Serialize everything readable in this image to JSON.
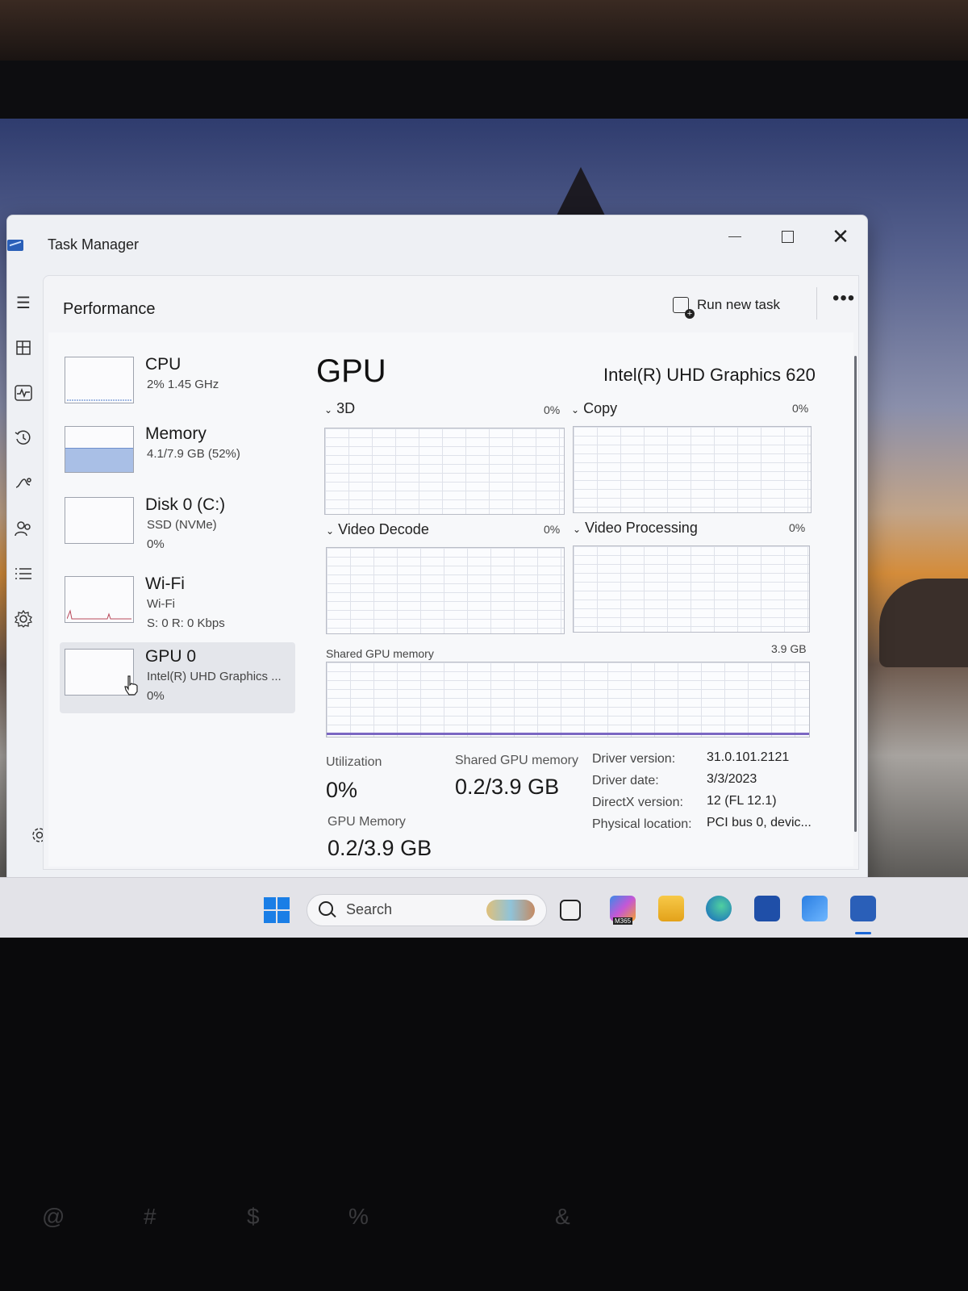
{
  "window": {
    "title": "Task Manager"
  },
  "header": {
    "section": "Performance",
    "run_task": "Run new task",
    "more": "•••"
  },
  "devices": [
    {
      "name": "CPU",
      "sub": "2%  1.45 GHz",
      "sub2": ""
    },
    {
      "name": "Memory",
      "sub": "4.1/7.9 GB (52%)",
      "sub2": "",
      "usage_fraction": 0.52
    },
    {
      "name": "Disk 0 (C:)",
      "sub": "SSD (NVMe)",
      "sub2": "0%"
    },
    {
      "name": "Wi-Fi",
      "sub": "Wi-Fi",
      "sub2": "S: 0  R: 0 Kbps"
    },
    {
      "name": "GPU 0",
      "sub": "Intel(R) UHD Graphics ...",
      "sub2": "0%"
    }
  ],
  "gpu": {
    "title": "GPU",
    "model": "Intel(R) UHD Graphics 620",
    "engines": [
      {
        "label": "3D",
        "pct": "0%"
      },
      {
        "label": "Copy",
        "pct": "0%"
      },
      {
        "label": "Video Decode",
        "pct": "0%"
      },
      {
        "label": "Video Processing",
        "pct": "0%"
      }
    ],
    "shared_label": "Shared GPU memory",
    "shared_max": "3.9 GB",
    "stats": {
      "utilization_label": "Utilization",
      "utilization": "0%",
      "shared_mem_label": "Shared GPU memory",
      "shared_mem": "0.2/3.9 GB",
      "gpu_mem_label": "GPU Memory",
      "gpu_mem": "0.2/3.9 GB"
    },
    "details": [
      {
        "key": "Driver version:",
        "value": "31.0.101.2121"
      },
      {
        "key": "Driver date:",
        "value": "3/3/2023"
      },
      {
        "key": "DirectX version:",
        "value": "12 (FL 12.1)"
      },
      {
        "key": "Physical location:",
        "value": "PCI bus 0, devic..."
      }
    ]
  },
  "taskbar": {
    "search_text": "Search",
    "m365_label": "M365"
  },
  "rail_icons": [
    "hamburger-icon",
    "processes-icon",
    "performance-icon",
    "app-history-icon",
    "startup-icon",
    "users-icon",
    "details-icon",
    "services-icon",
    "settings-icon"
  ]
}
